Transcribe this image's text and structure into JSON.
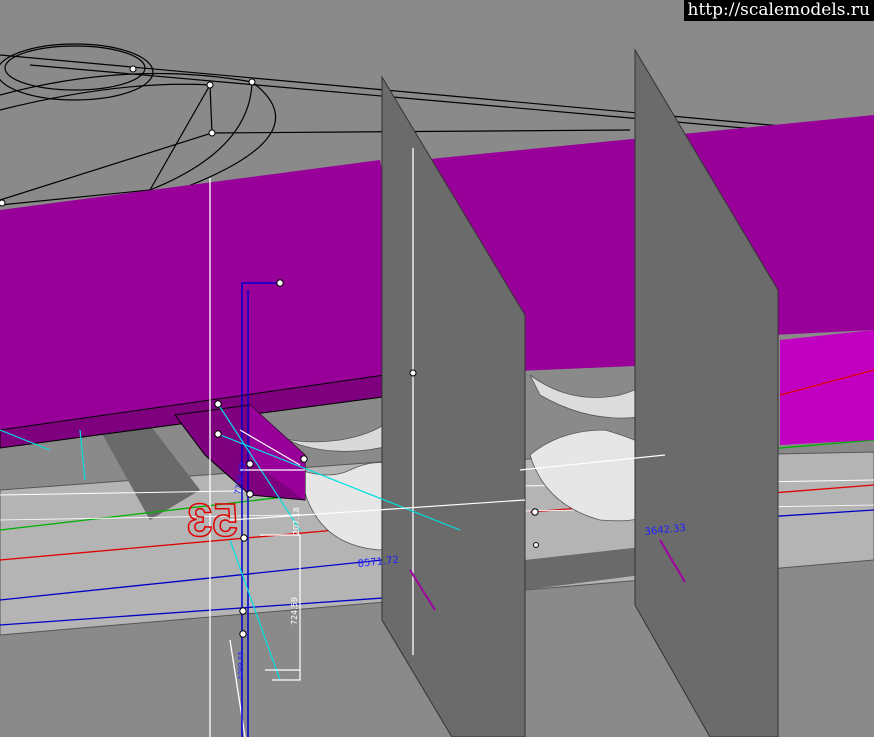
{
  "watermark": {
    "text": "http://scalemodels.ru"
  },
  "viewport": {
    "background_color": "#8a8a8a",
    "colors": {
      "wing_surface": "#99009a",
      "wing_underside": "#7f007f",
      "bulkhead": "#6b6b6b",
      "floor": "#b4b4b4",
      "intake_shading": "#d9d9d9",
      "axis_x": "#e00000",
      "axis_y": "#00b000",
      "guide_blue": "#0000c8",
      "guide_cyan": "#00e0e0",
      "wire": "#000000"
    }
  },
  "labels": {
    "part_number": "53",
    "dim_1": "207.18",
    "dim_2": "7720.02",
    "dim_3": "8571.72",
    "dim_4": "3642.33",
    "dim_5": "724.59",
    "dim_6": "4099.66"
  }
}
